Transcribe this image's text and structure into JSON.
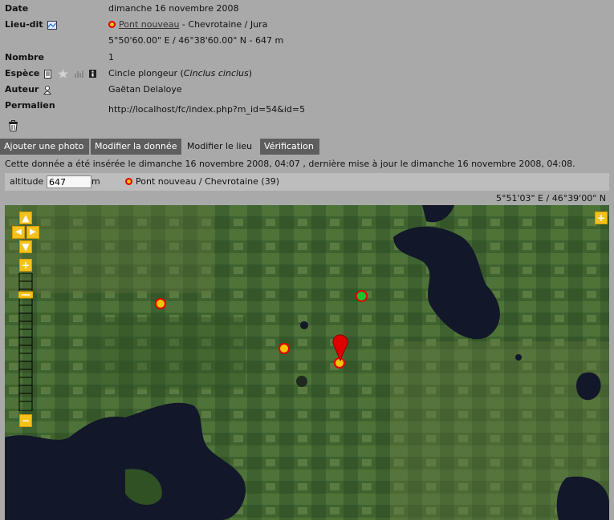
{
  "details": {
    "date": {
      "label": "Date",
      "value": "dimanche 16 novembre 2008"
    },
    "lieudit": {
      "label": "Lieu-dit",
      "place_link": "Pont nouveau",
      "place_rest": " - Chevrotaine / Jura",
      "coords": "5°50'60.00\" E / 46°38'60.00\" N - 647 m"
    },
    "nombre": {
      "label": "Nombre",
      "value": "1"
    },
    "espece": {
      "label": "Espèce",
      "common": "Cincle plongeur (",
      "latin": "Cinclus cinclus",
      "close": ")"
    },
    "auteur": {
      "label": "Auteur",
      "value": "Gaëtan Delaloye"
    },
    "permalien": {
      "label": "Permalien",
      "value": "http://localhost/fc/index.php?m_id=54&id=5"
    }
  },
  "tabs": [
    {
      "label": "Ajouter une photo"
    },
    {
      "label": "Modifier la donnée"
    },
    {
      "label": "Modifier le lieu",
      "active": true
    },
    {
      "label": "Vérification"
    }
  ],
  "info_text": "Cette donnée a été insérée le dimanche 16 novembre 2008, 04:07 , dernière mise à jour le dimanche 16 novembre 2008, 04:08.",
  "locbar": {
    "altitude_label": "altitude",
    "altitude_value": "647",
    "unit": "m",
    "place": "Pont nouveau / Chevrotaine (39)"
  },
  "map_coords": "5°51'03\" E / 46°39'00\" N",
  "colors": {
    "marker_fill": "#f5c400",
    "marker_border": "#e00000",
    "green_marker": "#22c030",
    "pin": "#e00000",
    "controls": "#f6c21a"
  },
  "icons": [
    "map-icon",
    "doc-icon",
    "star-icon",
    "chart-icon",
    "info-icon",
    "user-icon",
    "trash-icon"
  ]
}
